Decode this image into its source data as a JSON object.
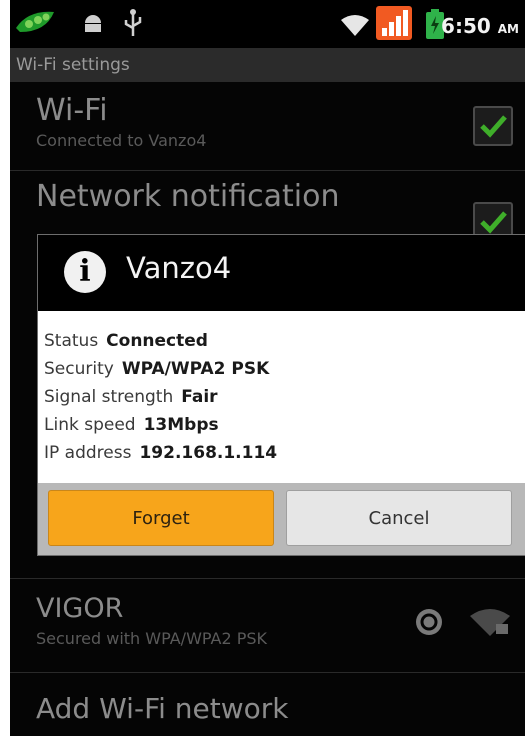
{
  "status_bar": {
    "time": "6:50",
    "ampm": "AM",
    "icons": [
      "pea-pod-icon",
      "android-debug-icon",
      "usb-icon",
      "wifi-icon",
      "signal-bars-icon",
      "battery-icon"
    ]
  },
  "screen": {
    "title": "Wi-Fi settings",
    "wifi": {
      "title": "Wi-Fi",
      "subtitle": "Connected to Vanzo4"
    },
    "network_notification": {
      "title": "Network notification"
    },
    "networks": [
      {
        "name": "VIGOR",
        "security": "Secured with WPA/WPA2 PSK"
      }
    ],
    "add_network": "Add Wi-Fi network"
  },
  "dialog": {
    "title": "Vanzo4",
    "icon": "info-icon",
    "details": [
      {
        "label": "Status",
        "value": "Connected"
      },
      {
        "label": "Security",
        "value": "WPA/WPA2 PSK"
      },
      {
        "label": "Signal strength",
        "value": "Fair"
      },
      {
        "label": "Link speed",
        "value": "13Mbps"
      },
      {
        "label": "IP address",
        "value": "192.168.1.114"
      }
    ],
    "buttons": {
      "forget": "Forget",
      "cancel": "Cancel"
    }
  },
  "colors": {
    "accent": "#f7a51b",
    "checkmark": "#3fae2a",
    "signal": "#f15a22"
  }
}
